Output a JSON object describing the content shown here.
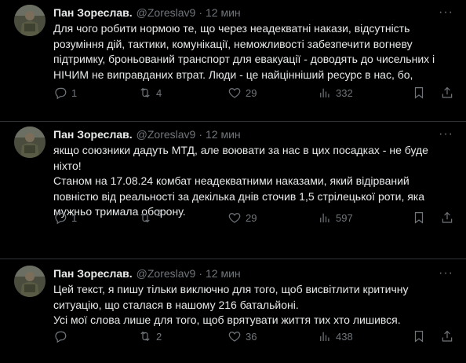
{
  "tweets": [
    {
      "author_name": "Пан Зореслав.",
      "handle": "@Zoreslav9",
      "separator": "·",
      "time": "12 мин",
      "text": "Для чого робити нормою те, що через неадекватні накази, відсутність\nрозуміння дій, тактики, комунікації, неможливості забезпечити вогневу\nпідтримку, броньований транспорт для евакуації - доводять до чисельних і\nНІЧИМ не виправданих втрат. Люди - це найцінніший ресурс в нас, бо,",
      "reply_count": "1",
      "retweet_count": "4",
      "like_count": "29",
      "view_count": "332"
    },
    {
      "author_name": "Пан Зореслав.",
      "handle": "@Zoreslav9",
      "separator": "·",
      "time": "12 мин",
      "text": "якщо союзники дадуть МТД, але воювати за нас в цих посадках - не буде\nніхто!\nСтаном на 17.08.24 комбат неадекватними наказами, який відірваний\nповністю від реальності за декілька днів сточив 1,5 стрілецької роти, яка\nмужньо тримала оборону.",
      "reply_count": "1",
      "retweet_count": "3",
      "like_count": "29",
      "view_count": "597"
    },
    {
      "author_name": "Пан Зореслав.",
      "handle": "@Zoreslav9",
      "separator": "·",
      "time": "12 мин",
      "text": "Цей текст, я пишу тільки виключно для того, щоб висвітлити критичну\nситуацію, що сталася в нашому 216 батальйоні.\nУсі мої слова лише для того, щоб врятувати життя тих хто лишився.",
      "reply_count": "",
      "retweet_count": "2",
      "like_count": "36",
      "view_count": "438"
    }
  ],
  "icons": {
    "more": "more-icon",
    "reply": "reply-icon",
    "retweet": "retweet-icon",
    "like": "heart-icon",
    "views": "views-icon",
    "bookmark": "bookmark-icon",
    "share": "share-icon"
  },
  "colors": {
    "background": "#000000",
    "text": "#e7e9ea",
    "secondary": "#71767b",
    "divider": "#2f3336"
  }
}
